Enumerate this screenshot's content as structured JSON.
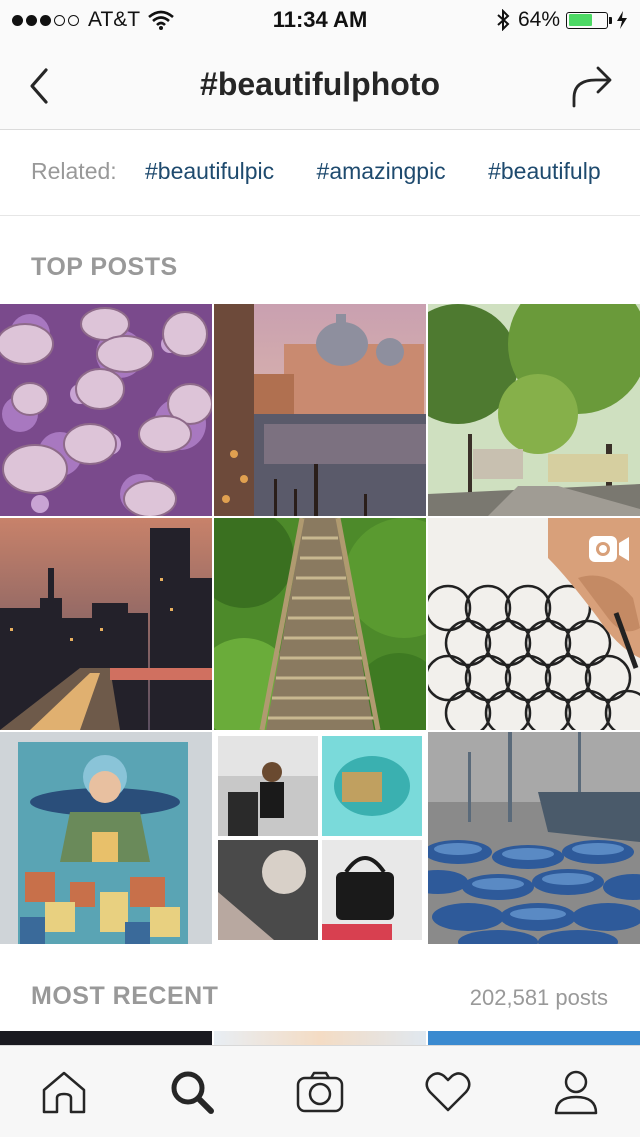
{
  "status": {
    "carrier": "AT&T",
    "time": "11:34 AM",
    "battery": "64%",
    "battery_level": 0.64
  },
  "nav": {
    "title": "#beautifulphoto",
    "back_icon": "chevron-left-icon",
    "share_icon": "share-arrow-icon"
  },
  "related": {
    "label": "Related:",
    "tags": [
      "#beautifulpic",
      "#amazingpic",
      "#beautifulp"
    ]
  },
  "top_posts": {
    "heading": "TOP POSTS",
    "tiles": [
      {
        "name": "lilac-macarons"
      },
      {
        "name": "venice-canal"
      },
      {
        "name": "tree-lined-street"
      },
      {
        "name": "city-skyline-dusk"
      },
      {
        "name": "forest-stairs"
      },
      {
        "name": "pattern-drawing-video",
        "video_icon": "video-camera-icon"
      },
      {
        "name": "mural-building"
      },
      {
        "name": "fashion-collage"
      },
      {
        "name": "blue-boats"
      }
    ]
  },
  "most_recent": {
    "heading": "MOST RECENT",
    "count": "202,581 posts"
  },
  "tabbar": {
    "items": [
      "home-icon",
      "search-icon",
      "camera-icon",
      "heart-icon",
      "profile-icon"
    ],
    "active": "search-icon"
  },
  "colors": {
    "tag": "#1e4a6e",
    "muted": "#999999",
    "battery_green": "#4cd964"
  }
}
